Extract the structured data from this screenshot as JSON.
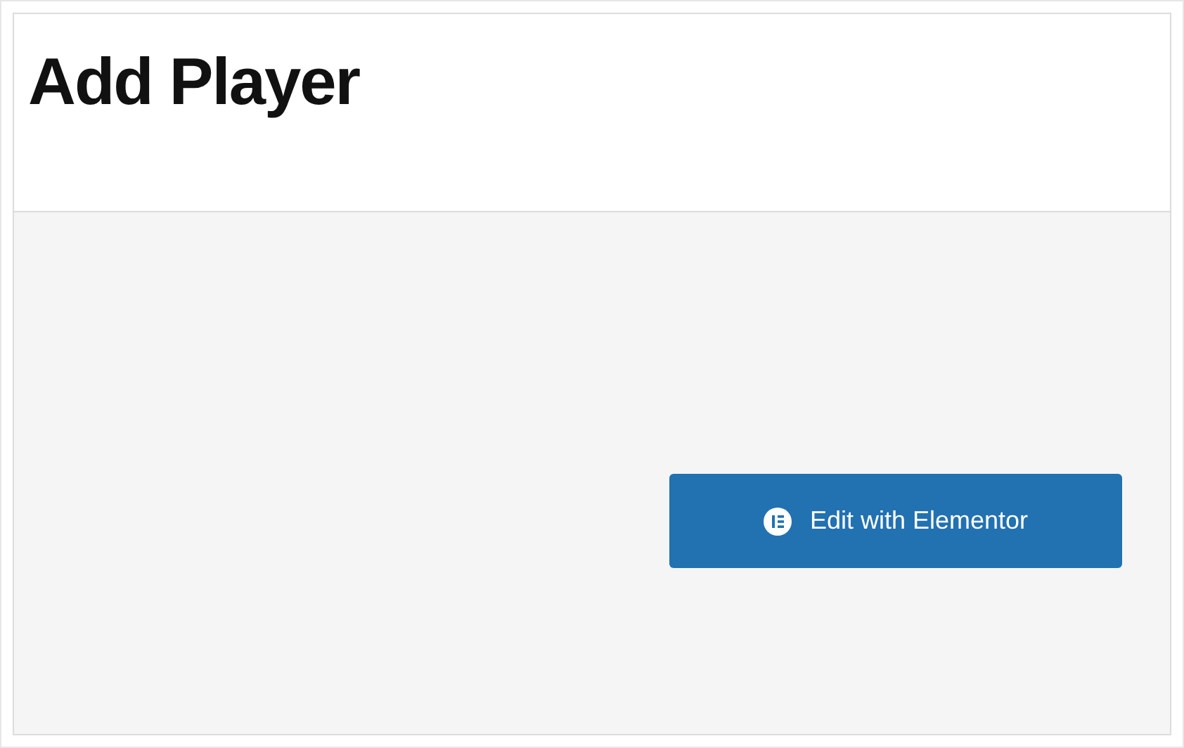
{
  "page": {
    "title": "Add Player"
  },
  "button": {
    "label": "Edit with Elementor"
  }
}
